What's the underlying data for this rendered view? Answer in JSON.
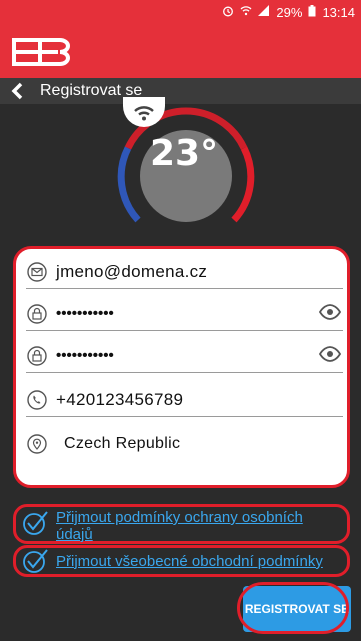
{
  "status_bar": {
    "battery_percent": "29%",
    "time": "13:14",
    "icons": [
      "alarm-icon",
      "wifi-icon",
      "signal-icon",
      "battery-icon"
    ]
  },
  "app": {
    "brand_color": "#e5303a",
    "logo_icon": "bob-logo-icon"
  },
  "header": {
    "title": "Registrovat se",
    "back_icon": "chevron-left-icon"
  },
  "thermostat": {
    "temperature": "23°",
    "wifi_icon": "wifi-icon"
  },
  "form": {
    "email": {
      "value": "jmeno@domena.cz",
      "icon": "mail-icon"
    },
    "password": {
      "value": "•••••••••••",
      "icon": "lock-icon",
      "toggle_icon": "eye-icon"
    },
    "password_confirm": {
      "value": "•••••••••••",
      "icon": "lock-icon",
      "toggle_icon": "eye-icon"
    },
    "phone": {
      "value": "+420123456789",
      "icon": "phone-icon"
    },
    "country": {
      "value": "Czech Republic",
      "icon": "location-pin-icon"
    }
  },
  "consents": {
    "privacy_label": "Přijmout podmínky ochrany osobních údajů",
    "privacy_checked": true,
    "terms_label": "Přijmout všeobecné obchodní podmínky",
    "terms_checked": true
  },
  "actions": {
    "register_label": "REGISTROVAT SE"
  }
}
